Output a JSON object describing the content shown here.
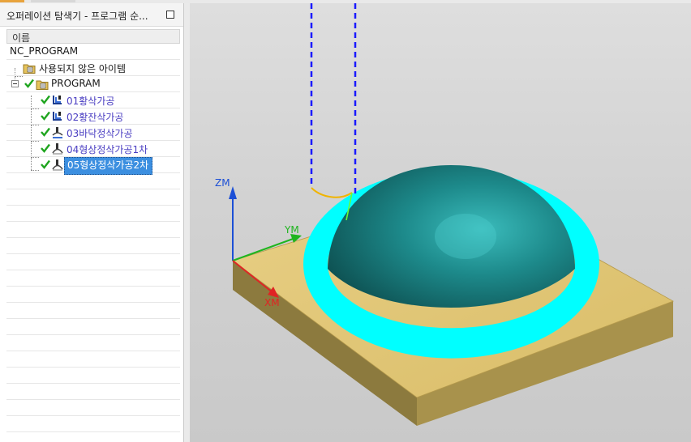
{
  "navigator": {
    "title": "오퍼레이션 탐색기 - 프로그램 순...",
    "column_header": "이름",
    "root": "NC_PROGRAM",
    "unused_items": "사용되지 않은 아이템",
    "program": "PROGRAM",
    "operations": [
      {
        "label": "01황삭가공",
        "icon": "cavity-mill-icon",
        "status": "complete"
      },
      {
        "label": "02황잔삭가공",
        "icon": "cavity-mill-icon",
        "status": "complete"
      },
      {
        "label": "03바닥정삭가공",
        "icon": "floor-finish-icon",
        "status": "complete"
      },
      {
        "label": "04형상정삭가공1차",
        "icon": "contour-finish-icon",
        "status": "complete"
      },
      {
        "label": "05형상정삭가공2차",
        "icon": "contour-finish-icon",
        "status": "complete",
        "selected": true
      }
    ]
  },
  "viewport": {
    "axes": {
      "z": "ZM",
      "y": "YM",
      "x": "XM"
    },
    "colors": {
      "stock": "#e2c77a",
      "dome": "#1d7f80",
      "toolpath": "#00ffff",
      "tool_axis": "#1a1aff",
      "z_axis": "#1c4fd6",
      "y_axis": "#1fb51f",
      "x_axis": "#e02424"
    }
  }
}
